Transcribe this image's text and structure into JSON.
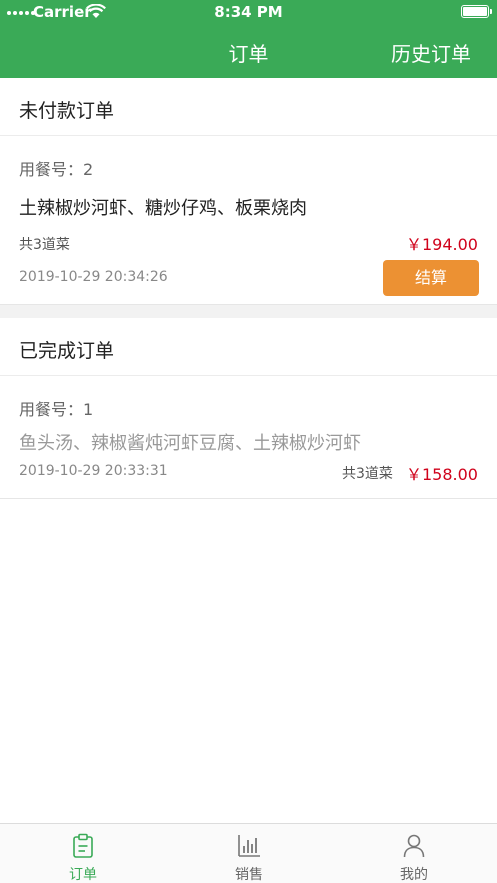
{
  "status_bar": {
    "carrier": "Carrier",
    "time": "8:34 PM"
  },
  "nav": {
    "title": "订单",
    "history_button": "历史订单"
  },
  "unpaid": {
    "section_label": "未付款订单",
    "order": {
      "meal_no": "用餐号：2",
      "dishes": "土辣椒炒河虾、糖炒仔鸡、板栗烧肉",
      "count": "共3道菜",
      "price": "￥194.00",
      "date": "2019-10-29 20:34:26",
      "pay_button": "结算"
    }
  },
  "completed": {
    "section_label": "已完成订单",
    "order": {
      "meal_no": "用餐号：1",
      "dishes": "鱼头汤、辣椒酱炖河虾豆腐、土辣椒炒河虾",
      "count": "共3道菜",
      "price": "￥158.00",
      "date": "2019-10-29 20:33:31"
    }
  },
  "tabbar": {
    "items": [
      {
        "label": "订单",
        "icon": "clipboard-icon",
        "active": true
      },
      {
        "label": "销售",
        "icon": "bar-chart-icon",
        "active": false
      },
      {
        "label": "我的",
        "icon": "person-icon",
        "active": false
      }
    ]
  },
  "colors": {
    "brand": "#3aaa57",
    "price": "#d0021b",
    "pay_button": "#ec9133"
  }
}
